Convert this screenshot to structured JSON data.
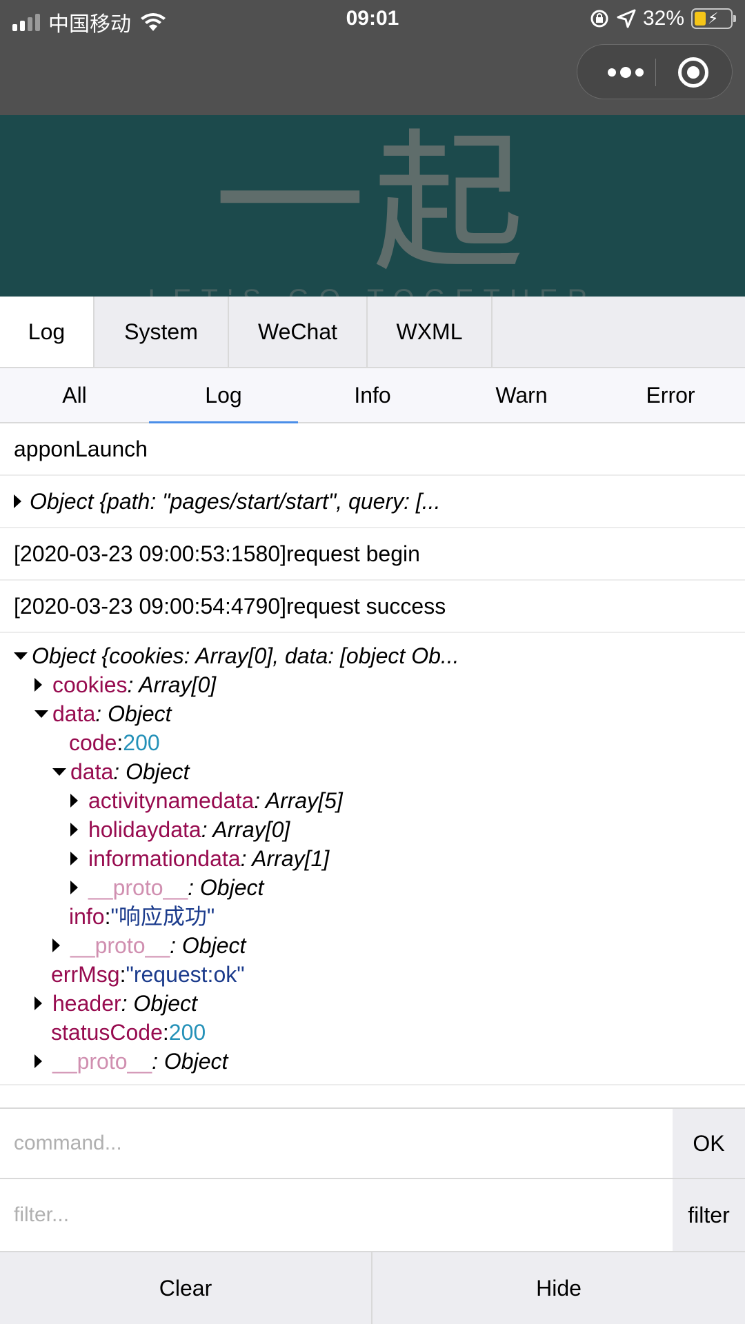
{
  "status_bar": {
    "carrier": "中国移动",
    "time": "09:01",
    "battery": "32%"
  },
  "banner": {
    "title": "一起",
    "subtitle": "LET'S GO TOGETHER"
  },
  "tabs": [
    {
      "label": "Log",
      "active": true
    },
    {
      "label": "System"
    },
    {
      "label": "WeChat"
    },
    {
      "label": "WXML"
    }
  ],
  "subtabs": [
    {
      "label": "All"
    },
    {
      "label": "Log",
      "active": true
    },
    {
      "label": "Info"
    },
    {
      "label": "Warn"
    },
    {
      "label": "Error"
    }
  ],
  "logs": {
    "line1": "apponLaunch",
    "line2": "Object {path: \"pages/start/start\", query: [...",
    "line3": "[2020-03-23 09:00:53:1580]request begin",
    "line4": "[2020-03-23 09:00:54:4790]request success",
    "tree": {
      "root": "Object {cookies: Array[0], data: [object Ob...",
      "cookies_key": "cookies",
      "cookies_val": ": Array[0]",
      "data_key": "data",
      "data_val": ": Object",
      "code_key": "code",
      "code_val": "200",
      "inner_data_key": "data",
      "inner_data_val": ": Object",
      "activity_key": "activitynamedata",
      "activity_val": ": Array[5]",
      "holiday_key": "holidaydata",
      "holiday_val": ": Array[0]",
      "information_key": "informationdata",
      "information_val": ": Array[1]",
      "proto_key": "__proto__",
      "proto_val": ": Object",
      "info_key": "info",
      "info_val": "\"响应成功\"",
      "errmsg_key": "errMsg",
      "errmsg_val": "\"request:ok\"",
      "header_key": "header",
      "header_val": ": Object",
      "status_key": "statusCode",
      "status_val": "200",
      "colon": ": "
    }
  },
  "command": {
    "placeholder": "command...",
    "button": "OK"
  },
  "filter": {
    "placeholder": "filter...",
    "button": "filter"
  },
  "bottom": {
    "clear": "Clear",
    "hide": "Hide"
  }
}
